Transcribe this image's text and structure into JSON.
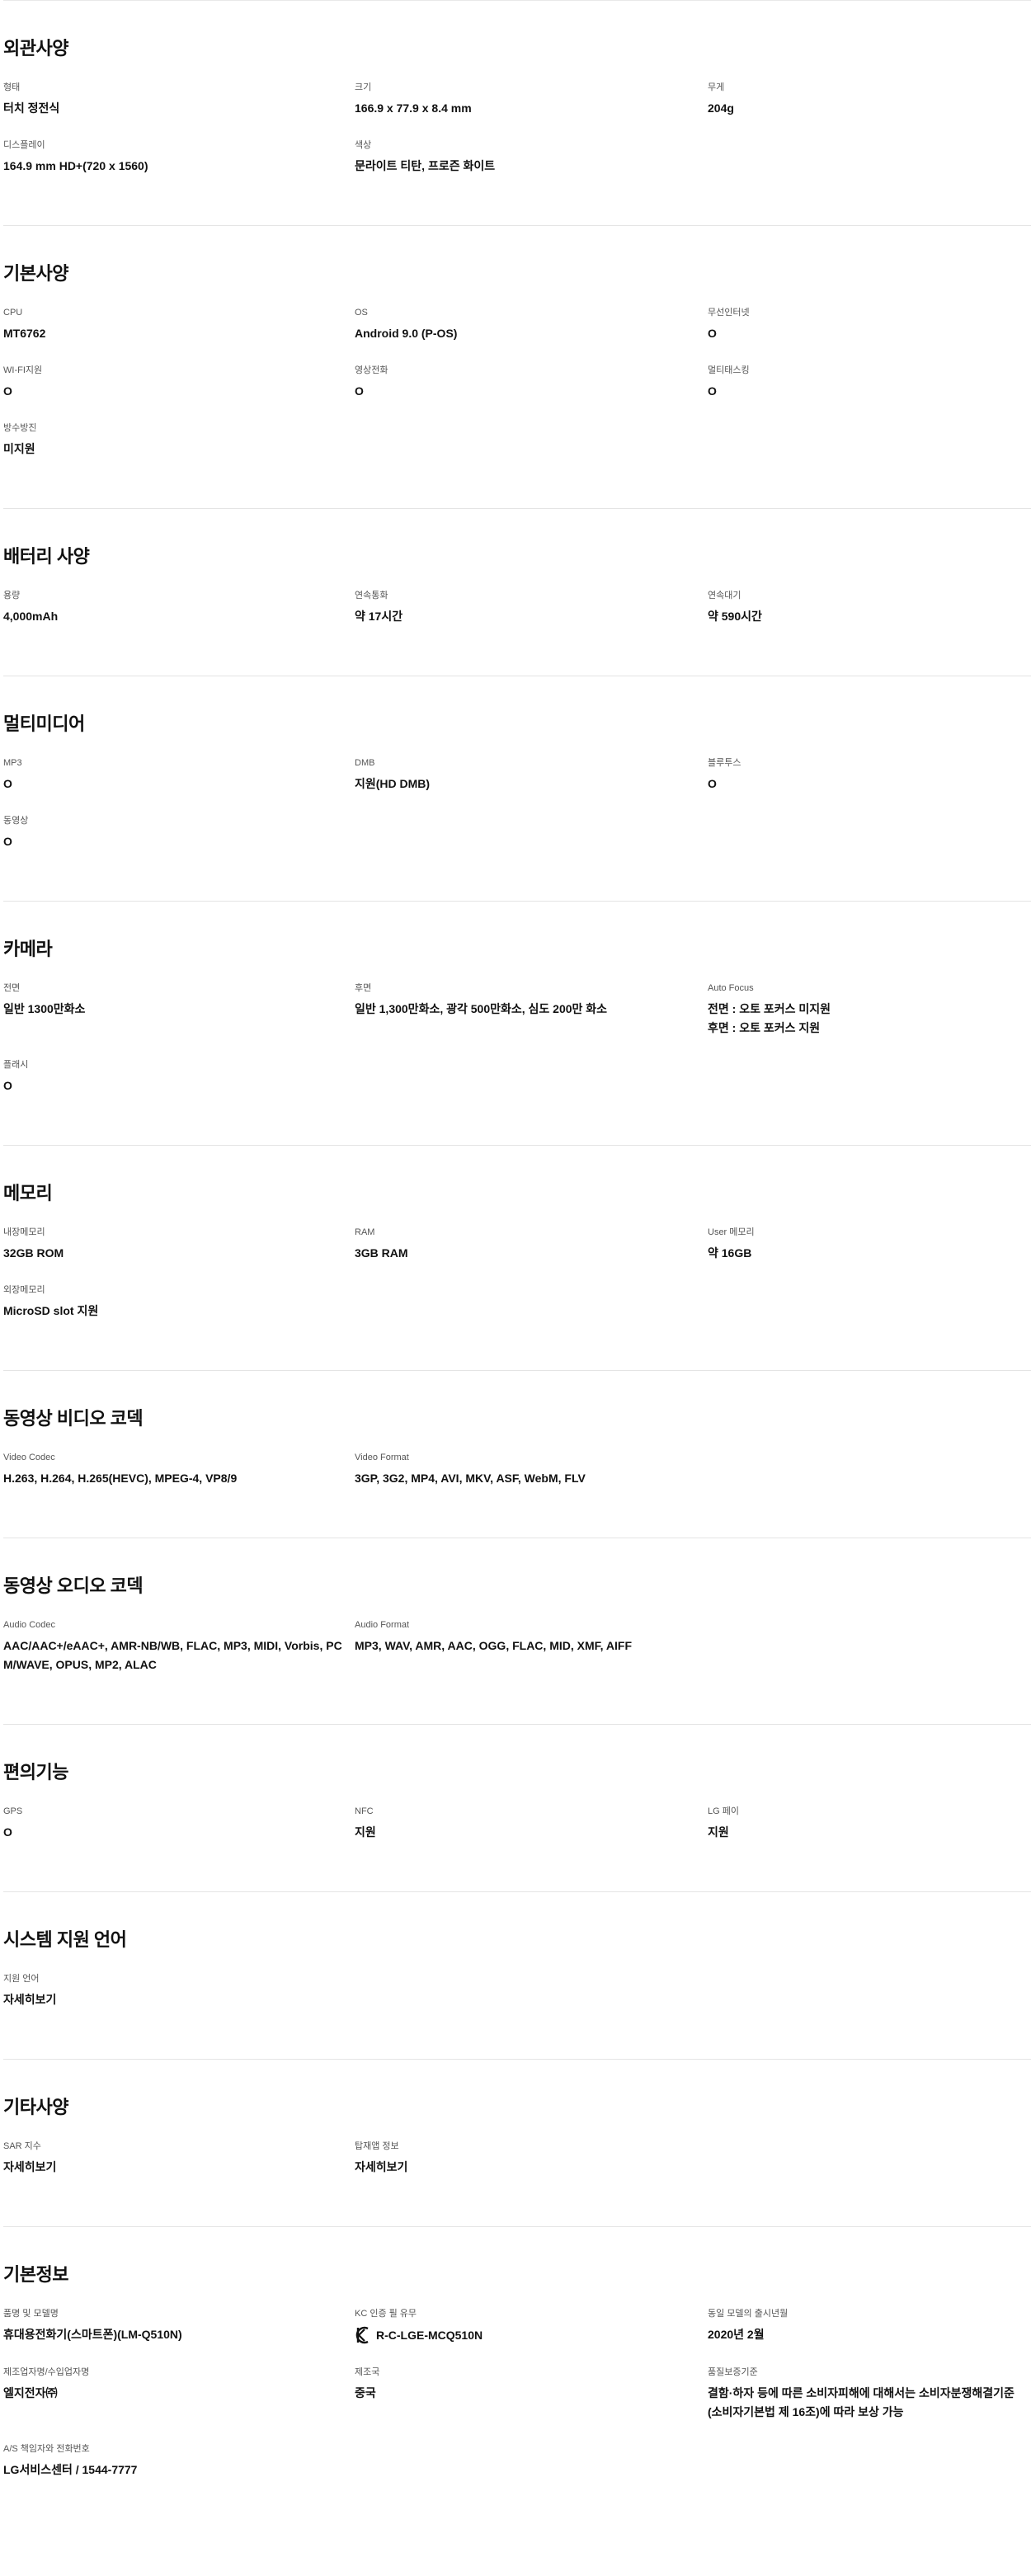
{
  "sections": [
    {
      "title": "외관사양",
      "items": [
        {
          "label": "형태",
          "value": "터치 정전식"
        },
        {
          "label": "크기",
          "value": "166.9 x 77.9 x 8.4 mm"
        },
        {
          "label": "무게",
          "value": "204g"
        },
        {
          "label": "디스플레이",
          "value": "164.9 mm HD+(720 x 1560)"
        },
        {
          "label": "색상",
          "value": "문라이트 티탄, 프로즌 화이트"
        }
      ]
    },
    {
      "title": "기본사양",
      "items": [
        {
          "label": "CPU",
          "value": "MT6762"
        },
        {
          "label": "OS",
          "value": "Android 9.0 (P-OS)"
        },
        {
          "label": "무선인터넷",
          "value": "O"
        },
        {
          "label": "WI-FI지원",
          "value": "O"
        },
        {
          "label": "영상전화",
          "value": "O"
        },
        {
          "label": "멀티태스킹",
          "value": "O"
        },
        {
          "label": "방수방진",
          "value": "미지원"
        }
      ]
    },
    {
      "title": "배터리 사양",
      "items": [
        {
          "label": "용량",
          "value": "4,000mAh"
        },
        {
          "label": "연속통화",
          "value": "약 17시간"
        },
        {
          "label": "연속대기",
          "value": "약 590시간"
        }
      ]
    },
    {
      "title": "멀티미디어",
      "items": [
        {
          "label": "MP3",
          "value": "O"
        },
        {
          "label": "DMB",
          "value": "지원(HD DMB)"
        },
        {
          "label": "블루투스",
          "value": "O"
        },
        {
          "label": "동영상",
          "value": "O"
        }
      ]
    },
    {
      "title": "카메라",
      "items": [
        {
          "label": "전면",
          "value": "일반 1300만화소"
        },
        {
          "label": "후면",
          "value": "일반 1,300만화소, 광각 500만화소, 심도 200만 화소"
        },
        {
          "label": "Auto Focus",
          "value": "전면 : 오토 포커스 미지원",
          "value2": "후면 : 오토 포커스 지원"
        },
        {
          "label": "플래시",
          "value": "O"
        }
      ]
    },
    {
      "title": "메모리",
      "items": [
        {
          "label": "내장메모리",
          "value": "32GB ROM"
        },
        {
          "label": "RAM",
          "value": "3GB RAM"
        },
        {
          "label": "User 메모리",
          "value": "약 16GB"
        },
        {
          "label": "외장메모리",
          "value": "MicroSD slot 지원"
        }
      ]
    },
    {
      "title": "동영상 비디오 코덱",
      "items": [
        {
          "label": "Video Codec",
          "value": "H.263, H.264, H.265(HEVC), MPEG-4, VP8/9"
        },
        {
          "label": "Video Format",
          "value": "3GP, 3G2, MP4, AVI, MKV, ASF, WebM, FLV"
        }
      ]
    },
    {
      "title": "동영상 오디오 코덱",
      "items": [
        {
          "label": "Audio Codec",
          "value": "AAC/AAC+/eAAC+, AMR-NB/WB, FLAC, MP3, MIDI, Vorbis, PCM/WAVE, OPUS, MP2, ALAC"
        },
        {
          "label": "Audio Format",
          "value": "MP3, WAV, AMR, AAC, OGG, FLAC, MID, XMF, AIFF"
        }
      ]
    },
    {
      "title": "편의기능",
      "items": [
        {
          "label": "GPS",
          "value": "O"
        },
        {
          "label": "NFC",
          "value": "지원"
        },
        {
          "label": "LG 페이",
          "value": "지원"
        }
      ]
    },
    {
      "title": "시스템 지원 언어",
      "items": [
        {
          "label": "지원 언어",
          "value": "자세히보기",
          "link": true
        }
      ]
    },
    {
      "title": "기타사양",
      "items": [
        {
          "label": "SAR 지수",
          "value": "자세히보기",
          "link": true
        },
        {
          "label": "탑재앱 정보",
          "value": "자세히보기",
          "link": true
        }
      ]
    },
    {
      "title": "기본정보",
      "items": [
        {
          "label": "품명 및 모델명",
          "value": "휴대용전화기(스마트폰)(LM-Q510N)"
        },
        {
          "label": "KC 인증 필 유무",
          "value": "R-C-LGE-MCQ510N",
          "kc": true
        },
        {
          "label": "동일 모델의 출시년월",
          "value": "2020년 2월"
        },
        {
          "label": "제조업자명/수입업자명",
          "value": "엘지전자㈜"
        },
        {
          "label": "제조국",
          "value": "중국"
        },
        {
          "label": "품질보증기준",
          "value": "결함·하자 등에 따른 소비자피해에 대해서는 소비자분쟁해결기준(소비자기본법 제 16조)에 따라 보상 가능"
        },
        {
          "label": "A/S 책임자와 전화번호",
          "value": "LG서비스센터 / 1544-7777"
        }
      ]
    }
  ],
  "icons": {
    "kc_mark": "kc-certification-icon"
  }
}
